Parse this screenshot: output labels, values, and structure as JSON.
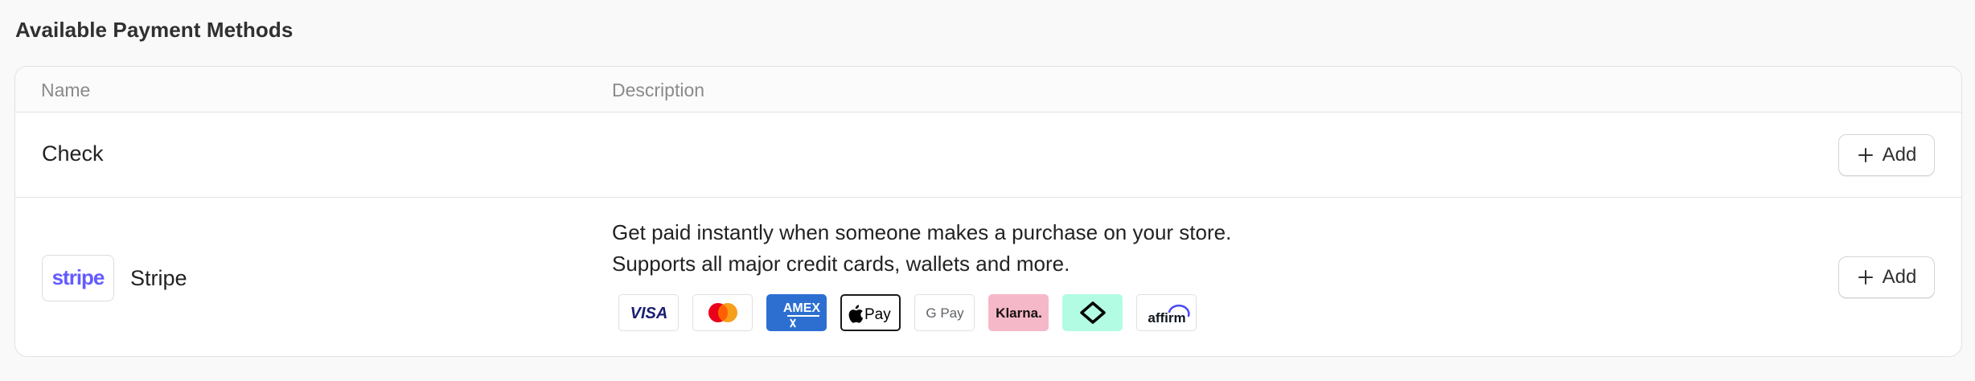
{
  "section": {
    "title": "Available Payment Methods"
  },
  "table": {
    "columns": {
      "name": "Name",
      "description": "Description"
    },
    "rows": [
      {
        "name": "Check",
        "description_lines": [],
        "action_label": "Add"
      },
      {
        "name": "Stripe",
        "logo_text": "stripe",
        "description_lines": [
          "Get paid instantly when someone makes a purchase on your store.",
          "Supports all major credit cards, wallets and more."
        ],
        "action_label": "Add",
        "payment_badges": [
          {
            "icon": "visa-icon",
            "text": "VISA"
          },
          {
            "icon": "mastercard-icon"
          },
          {
            "icon": "amex-icon",
            "text": "AMEX"
          },
          {
            "icon": "apple-pay-icon",
            "text": "Pay"
          },
          {
            "icon": "google-pay-icon",
            "text": "G Pay"
          },
          {
            "icon": "klarna-icon",
            "text": "Klarna."
          },
          {
            "icon": "afterpay-icon"
          },
          {
            "icon": "affirm-icon",
            "text": "affirm"
          }
        ]
      }
    ]
  },
  "colors": {
    "stripe_brand": "#635bff",
    "amex_blue": "#2c6fd1",
    "klarna_pink": "#f5b8c8",
    "afterpay_mint": "#b2fce4",
    "affirm_blue": "#4a4af4"
  }
}
